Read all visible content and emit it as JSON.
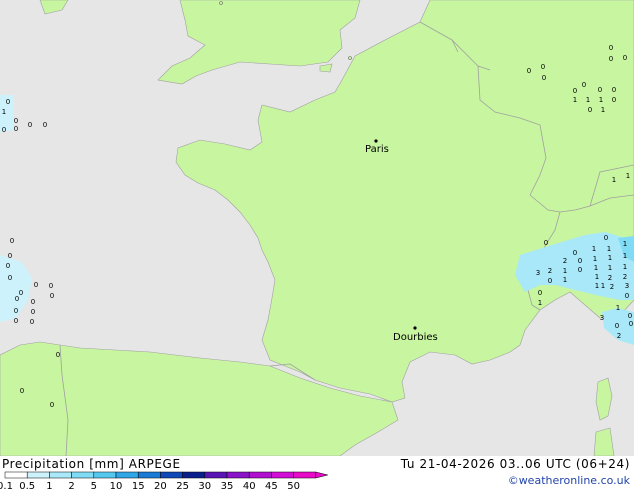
{
  "footer": {
    "title_left": "Precipitation [mm]  ARPEGE",
    "title_right": "Tu 21-04-2026 03..06 UTC (06+24)",
    "credit": "©weatheronline.co.uk"
  },
  "legend": {
    "labels": [
      "0.1",
      "0.5",
      "1",
      "2",
      "5",
      "10",
      "15",
      "20",
      "25",
      "30",
      "35",
      "40",
      "45",
      "50"
    ],
    "colors": [
      "#ffffff",
      "#cdf2fb",
      "#a8e8f8",
      "#7fdcf4",
      "#55c8f0",
      "#2fa6e6",
      "#1b7ad6",
      "#1148b8",
      "#0a1f8c",
      "#5a14b4",
      "#8a12c8",
      "#b210d0",
      "#d20ed6",
      "#e80cc8"
    ]
  },
  "map": {
    "land_color": "#c8f5a0",
    "sea_color": "#e6e6e6",
    "border_color": "#a0a0a0",
    "cities": [
      {
        "name": "Paris"
      },
      {
        "name": "Dourbies"
      }
    ],
    "precip_values": [
      "0",
      "1",
      "0",
      "0",
      "0",
      "0",
      "0",
      "0",
      "0",
      "0",
      "0",
      "0",
      "0",
      "0",
      "0",
      "0",
      "0",
      "0",
      "0",
      "0",
      "0",
      "0",
      "0",
      "0",
      "0",
      "0",
      "0",
      "0",
      "0",
      "0",
      "0",
      "0",
      "1",
      "1",
      "1",
      "0",
      "0",
      "1",
      "0",
      "0",
      "1",
      "1",
      "1",
      "2",
      "0",
      "1",
      "1",
      "1",
      "2",
      "1",
      "0",
      "1",
      "1",
      "3",
      "1",
      "1",
      "0",
      "1",
      "2",
      "2",
      "1",
      "1",
      "2",
      "3",
      "0",
      "0",
      "1",
      "1",
      "0",
      "3",
      "0",
      "2",
      "0",
      "0",
      "1",
      "1",
      "0",
      "0",
      "0",
      "0",
      "1",
      "1",
      "0",
      "0",
      "1",
      "0",
      "1",
      "0",
      "1",
      "0",
      "0",
      "1",
      "1",
      "0",
      "0",
      "0",
      "0",
      "0",
      "0"
    ]
  }
}
